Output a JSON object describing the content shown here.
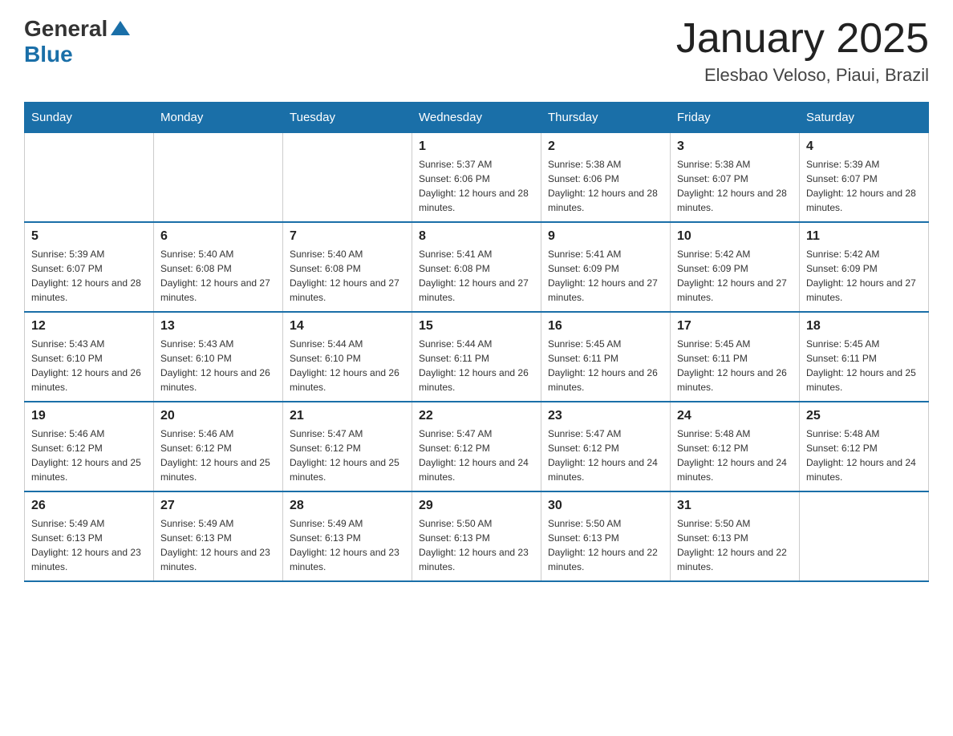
{
  "logo": {
    "general": "General",
    "blue": "Blue"
  },
  "header": {
    "title": "January 2025",
    "subtitle": "Elesbao Veloso, Piaui, Brazil"
  },
  "weekdays": [
    "Sunday",
    "Monday",
    "Tuesday",
    "Wednesday",
    "Thursday",
    "Friday",
    "Saturday"
  ],
  "weeks": [
    [
      {
        "day": "",
        "info": ""
      },
      {
        "day": "",
        "info": ""
      },
      {
        "day": "",
        "info": ""
      },
      {
        "day": "1",
        "info": "Sunrise: 5:37 AM\nSunset: 6:06 PM\nDaylight: 12 hours and 28 minutes."
      },
      {
        "day": "2",
        "info": "Sunrise: 5:38 AM\nSunset: 6:06 PM\nDaylight: 12 hours and 28 minutes."
      },
      {
        "day": "3",
        "info": "Sunrise: 5:38 AM\nSunset: 6:07 PM\nDaylight: 12 hours and 28 minutes."
      },
      {
        "day": "4",
        "info": "Sunrise: 5:39 AM\nSunset: 6:07 PM\nDaylight: 12 hours and 28 minutes."
      }
    ],
    [
      {
        "day": "5",
        "info": "Sunrise: 5:39 AM\nSunset: 6:07 PM\nDaylight: 12 hours and 28 minutes."
      },
      {
        "day": "6",
        "info": "Sunrise: 5:40 AM\nSunset: 6:08 PM\nDaylight: 12 hours and 27 minutes."
      },
      {
        "day": "7",
        "info": "Sunrise: 5:40 AM\nSunset: 6:08 PM\nDaylight: 12 hours and 27 minutes."
      },
      {
        "day": "8",
        "info": "Sunrise: 5:41 AM\nSunset: 6:08 PM\nDaylight: 12 hours and 27 minutes."
      },
      {
        "day": "9",
        "info": "Sunrise: 5:41 AM\nSunset: 6:09 PM\nDaylight: 12 hours and 27 minutes."
      },
      {
        "day": "10",
        "info": "Sunrise: 5:42 AM\nSunset: 6:09 PM\nDaylight: 12 hours and 27 minutes."
      },
      {
        "day": "11",
        "info": "Sunrise: 5:42 AM\nSunset: 6:09 PM\nDaylight: 12 hours and 27 minutes."
      }
    ],
    [
      {
        "day": "12",
        "info": "Sunrise: 5:43 AM\nSunset: 6:10 PM\nDaylight: 12 hours and 26 minutes."
      },
      {
        "day": "13",
        "info": "Sunrise: 5:43 AM\nSunset: 6:10 PM\nDaylight: 12 hours and 26 minutes."
      },
      {
        "day": "14",
        "info": "Sunrise: 5:44 AM\nSunset: 6:10 PM\nDaylight: 12 hours and 26 minutes."
      },
      {
        "day": "15",
        "info": "Sunrise: 5:44 AM\nSunset: 6:11 PM\nDaylight: 12 hours and 26 minutes."
      },
      {
        "day": "16",
        "info": "Sunrise: 5:45 AM\nSunset: 6:11 PM\nDaylight: 12 hours and 26 minutes."
      },
      {
        "day": "17",
        "info": "Sunrise: 5:45 AM\nSunset: 6:11 PM\nDaylight: 12 hours and 26 minutes."
      },
      {
        "day": "18",
        "info": "Sunrise: 5:45 AM\nSunset: 6:11 PM\nDaylight: 12 hours and 25 minutes."
      }
    ],
    [
      {
        "day": "19",
        "info": "Sunrise: 5:46 AM\nSunset: 6:12 PM\nDaylight: 12 hours and 25 minutes."
      },
      {
        "day": "20",
        "info": "Sunrise: 5:46 AM\nSunset: 6:12 PM\nDaylight: 12 hours and 25 minutes."
      },
      {
        "day": "21",
        "info": "Sunrise: 5:47 AM\nSunset: 6:12 PM\nDaylight: 12 hours and 25 minutes."
      },
      {
        "day": "22",
        "info": "Sunrise: 5:47 AM\nSunset: 6:12 PM\nDaylight: 12 hours and 24 minutes."
      },
      {
        "day": "23",
        "info": "Sunrise: 5:47 AM\nSunset: 6:12 PM\nDaylight: 12 hours and 24 minutes."
      },
      {
        "day": "24",
        "info": "Sunrise: 5:48 AM\nSunset: 6:12 PM\nDaylight: 12 hours and 24 minutes."
      },
      {
        "day": "25",
        "info": "Sunrise: 5:48 AM\nSunset: 6:12 PM\nDaylight: 12 hours and 24 minutes."
      }
    ],
    [
      {
        "day": "26",
        "info": "Sunrise: 5:49 AM\nSunset: 6:13 PM\nDaylight: 12 hours and 23 minutes."
      },
      {
        "day": "27",
        "info": "Sunrise: 5:49 AM\nSunset: 6:13 PM\nDaylight: 12 hours and 23 minutes."
      },
      {
        "day": "28",
        "info": "Sunrise: 5:49 AM\nSunset: 6:13 PM\nDaylight: 12 hours and 23 minutes."
      },
      {
        "day": "29",
        "info": "Sunrise: 5:50 AM\nSunset: 6:13 PM\nDaylight: 12 hours and 23 minutes."
      },
      {
        "day": "30",
        "info": "Sunrise: 5:50 AM\nSunset: 6:13 PM\nDaylight: 12 hours and 22 minutes."
      },
      {
        "day": "31",
        "info": "Sunrise: 5:50 AM\nSunset: 6:13 PM\nDaylight: 12 hours and 22 minutes."
      },
      {
        "day": "",
        "info": ""
      }
    ]
  ]
}
